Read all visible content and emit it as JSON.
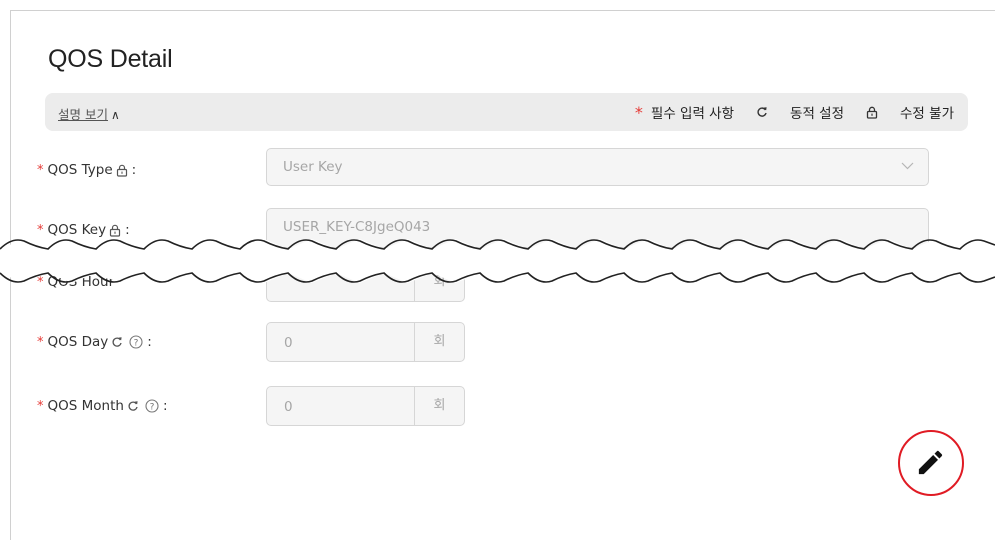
{
  "page": {
    "title": "QOS Detail"
  },
  "info_bar": {
    "help_label": "설명 보기",
    "legend": {
      "required_marker": "*",
      "required_label": "필수 입력 사항",
      "dynamic_label": "동적 설정",
      "locked_label": "수정 불가"
    }
  },
  "fields": {
    "qos_type": {
      "label": "QOS Type",
      "value": "User Key",
      "required": true,
      "locked": true
    },
    "qos_key": {
      "label": "QOS Key",
      "value": "USER_KEY-C8JgeQ043",
      "required": true,
      "locked": true
    },
    "qos_hour": {
      "label": "QOS Hour",
      "value": "",
      "unit": "회"
    },
    "qos_day": {
      "label": "QOS Day",
      "value": "0",
      "unit": "회",
      "required": true,
      "dynamic": true,
      "help": true
    },
    "qos_month": {
      "label": "QOS Month",
      "value": "0",
      "unit": "회",
      "required": true,
      "dynamic": true,
      "help": true
    }
  },
  "colors": {
    "required": "#e53935",
    "accent_red": "#e01b24",
    "field_bg": "#f5f5f5",
    "info_bar_bg": "#ececec"
  },
  "icons": {
    "lock": "lock-icon",
    "dynamic": "refresh-icon",
    "help": "question-circle-icon",
    "dropdown": "chevron-down-icon",
    "edit": "pencil-icon"
  }
}
